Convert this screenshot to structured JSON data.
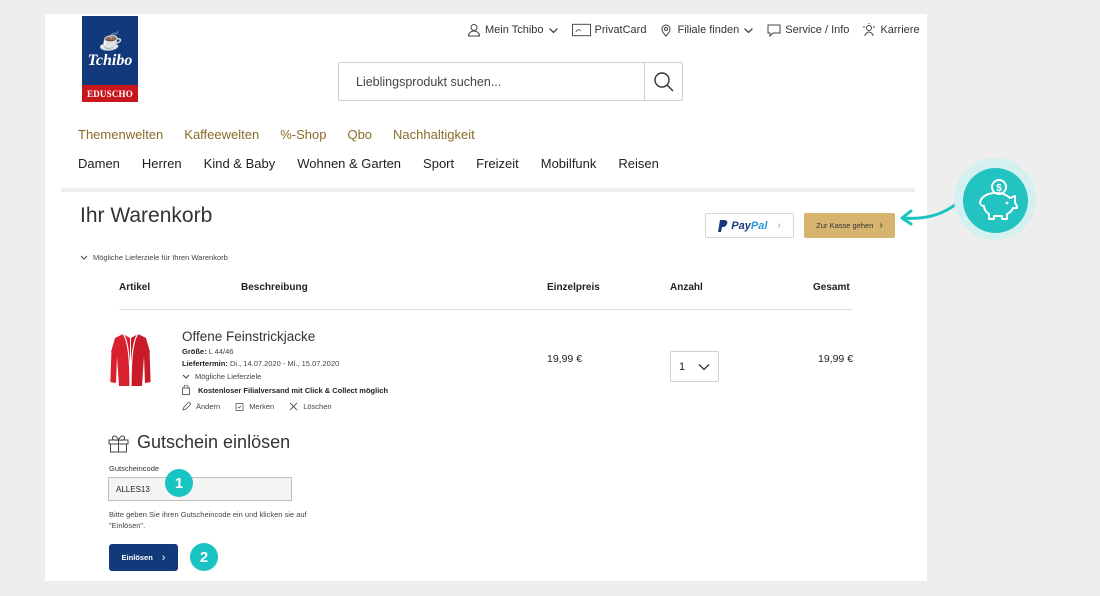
{
  "brand": {
    "logo_top": "Tchibo",
    "logo_bottom": "EDUSCHO"
  },
  "topnav": [
    {
      "label": "Mein Tchibo",
      "icon": "user-icon",
      "dropdown": true
    },
    {
      "label": "PrivatCard",
      "icon": "card-icon",
      "dropdown": false
    },
    {
      "label": "Filiale finden",
      "icon": "location-pin-icon",
      "dropdown": true
    },
    {
      "label": "Service / Info",
      "icon": "chat-icon",
      "dropdown": false
    },
    {
      "label": "Karriere",
      "icon": "career-icon",
      "dropdown": false
    }
  ],
  "search": {
    "placeholder": "Lieblingsprodukt suchen..."
  },
  "nav_primary": [
    "Themenwelten",
    "Kaffeewelten",
    "%-Shop",
    "Qbo",
    "Nachhaltigkeit"
  ],
  "nav_secondary": [
    "Damen",
    "Herren",
    "Kind & Baby",
    "Wohnen & Garten",
    "Sport",
    "Freizeit",
    "Mobilfunk",
    "Reisen"
  ],
  "cart": {
    "title": "Ihr Warenkorb",
    "paypal_label": {
      "part1": "Pay",
      "part2": "Pal"
    },
    "checkout_label": "Zur Kasse gehen",
    "delivery_toggle": "Mögliche Lieferziele für Ihren Warenkorb",
    "headers": {
      "article": "Artikel",
      "description": "Beschreibung",
      "unit_price": "Einzelpreis",
      "quantity": "Anzahl",
      "total": "Gesamt"
    },
    "item": {
      "name": "Offene Feinstrickjacke",
      "size_label": "Größe:",
      "size": "L 44/46",
      "delivery_label": "Liefertermin:",
      "delivery": "Di., 14.07.2020 - Mi., 15.07.2020",
      "delivery_toggle": "Mögliche Lieferziele",
      "shipping_note": "Kostenloser Filialversand mit Click & Collect möglich",
      "unit_price": "19,99 €",
      "quantity": "1",
      "total": "19,99 €",
      "actions": {
        "edit": "Ändern",
        "save": "Merken",
        "delete": "Löschen"
      },
      "color": "#d8202e"
    }
  },
  "voucher": {
    "title": "Gutschein einlösen",
    "field_label": "Gutscheincode",
    "code": "ALLES13",
    "hint": "Bitte geben Sie ihren Gutscheincode ein und klicken sie auf \"Einlösen\".",
    "button_label": "Einlösen"
  },
  "annotations": {
    "step1": "1",
    "step2": "2",
    "accent": "#18c4c1"
  }
}
